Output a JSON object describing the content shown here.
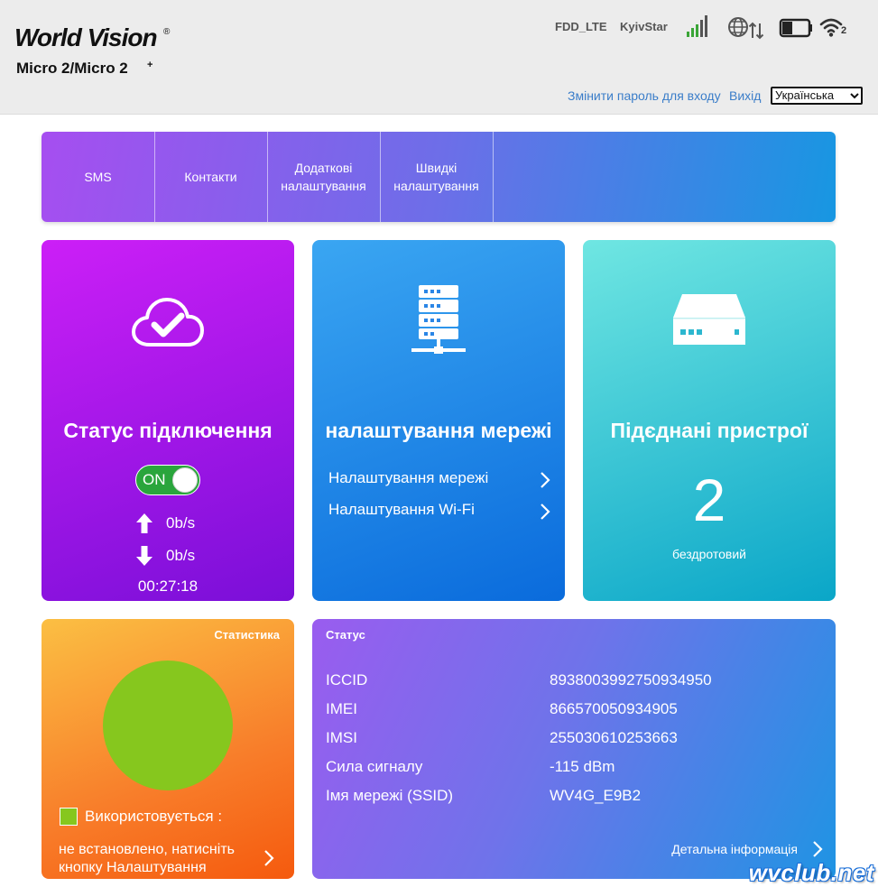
{
  "header": {
    "brand": "World Vision",
    "brand_mark": "®",
    "model": "Micro 2/Micro 2",
    "model_plus": "+",
    "network_type": "FDD_LTE",
    "operator": "KyivStar",
    "wifi_clients": "2",
    "change_password": "Змінити пароль для входу",
    "logout": "Вихід",
    "language": "Українська"
  },
  "menu": {
    "items": [
      {
        "label": "SMS"
      },
      {
        "label": "Контакти"
      },
      {
        "label": "Додаткові налаштування"
      },
      {
        "label": "Швидкі налаштування"
      }
    ]
  },
  "connection": {
    "title": "Статус підключення",
    "toggle_label": "ON",
    "upload_rate": "0b/s",
    "download_rate": "0b/s",
    "timer": "00:27:18"
  },
  "network": {
    "title": "налаштування мережі",
    "links": [
      "Налаштування мережі",
      "Налаштування Wi-Fi"
    ]
  },
  "devices": {
    "title": "Підєднані пристрої",
    "count": "2",
    "type_label": "бездротовий"
  },
  "statistics": {
    "title": "Статистика",
    "legend_label": "Використовується  :",
    "message": "не встановлено, натисніть кнопку Налаштування",
    "used_fraction": 1.0,
    "color": "#86c71e"
  },
  "status": {
    "title": "Статус",
    "rows": [
      {
        "key": "ICCID",
        "value": "8938003992750934950"
      },
      {
        "key": "IMEI",
        "value": "866570050934905"
      },
      {
        "key": "IMSI",
        "value": "255030610253663"
      },
      {
        "key": "Сила сигналу",
        "value": "-115 dBm"
      },
      {
        "key": "Імя мережі (SSID)",
        "value": "WV4G_E9B2"
      }
    ],
    "details_link": "Детальна інформація"
  },
  "watermark": "wvclub.net"
}
